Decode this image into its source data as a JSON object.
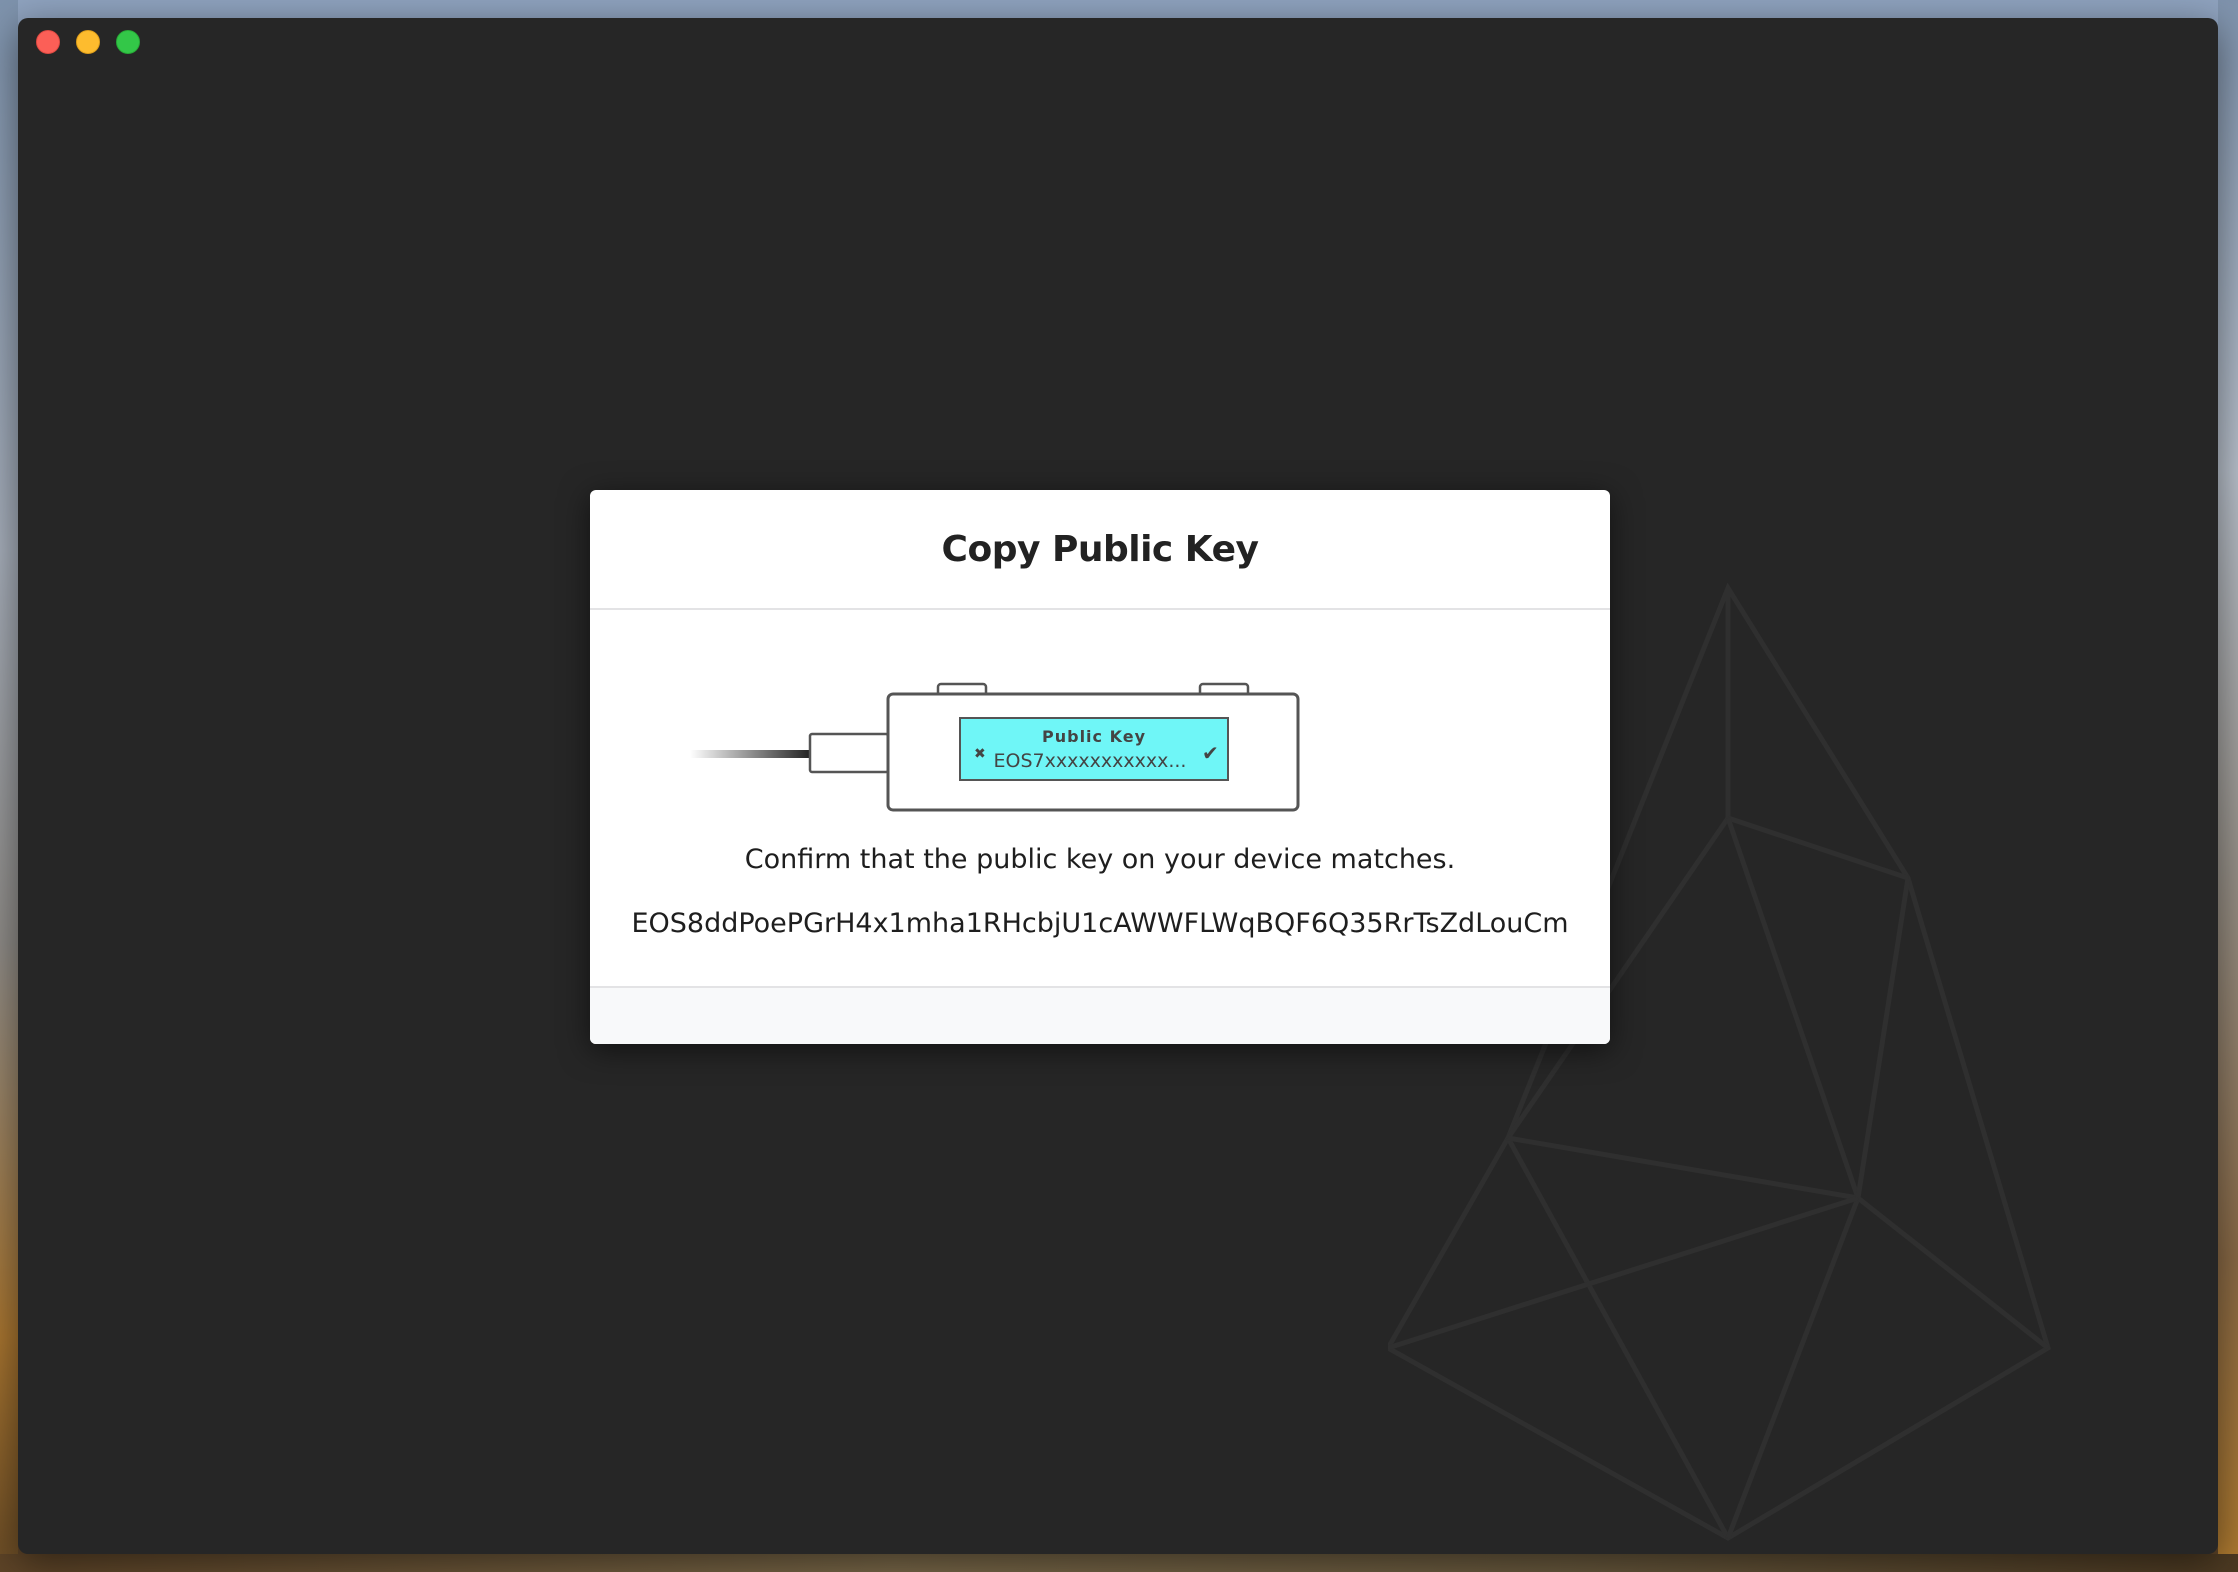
{
  "window": {
    "controls": [
      "close",
      "minimize",
      "maximize"
    ]
  },
  "modal": {
    "title": "Copy Public Key",
    "device": {
      "screen_title": "Public Key",
      "screen_value": "EOS7xxxxxxxxxxx...",
      "reject_glyph": "✖",
      "accept_glyph": "✔",
      "screen_color": "#6ff6f7"
    },
    "confirm_message": "Confirm that the public key on your device matches.",
    "public_key": "EOS8ddPoePGrH4x1mha1RHcbjU1cAWWFLWqBQF6Q35RrTsZdLouCm"
  },
  "colors": {
    "window_bg": "#262626",
    "modal_bg": "#ffffff",
    "footer_bg": "#f8f9fa",
    "close": "#fc5f57",
    "minimize": "#fdbc2e",
    "maximize": "#33c748"
  }
}
